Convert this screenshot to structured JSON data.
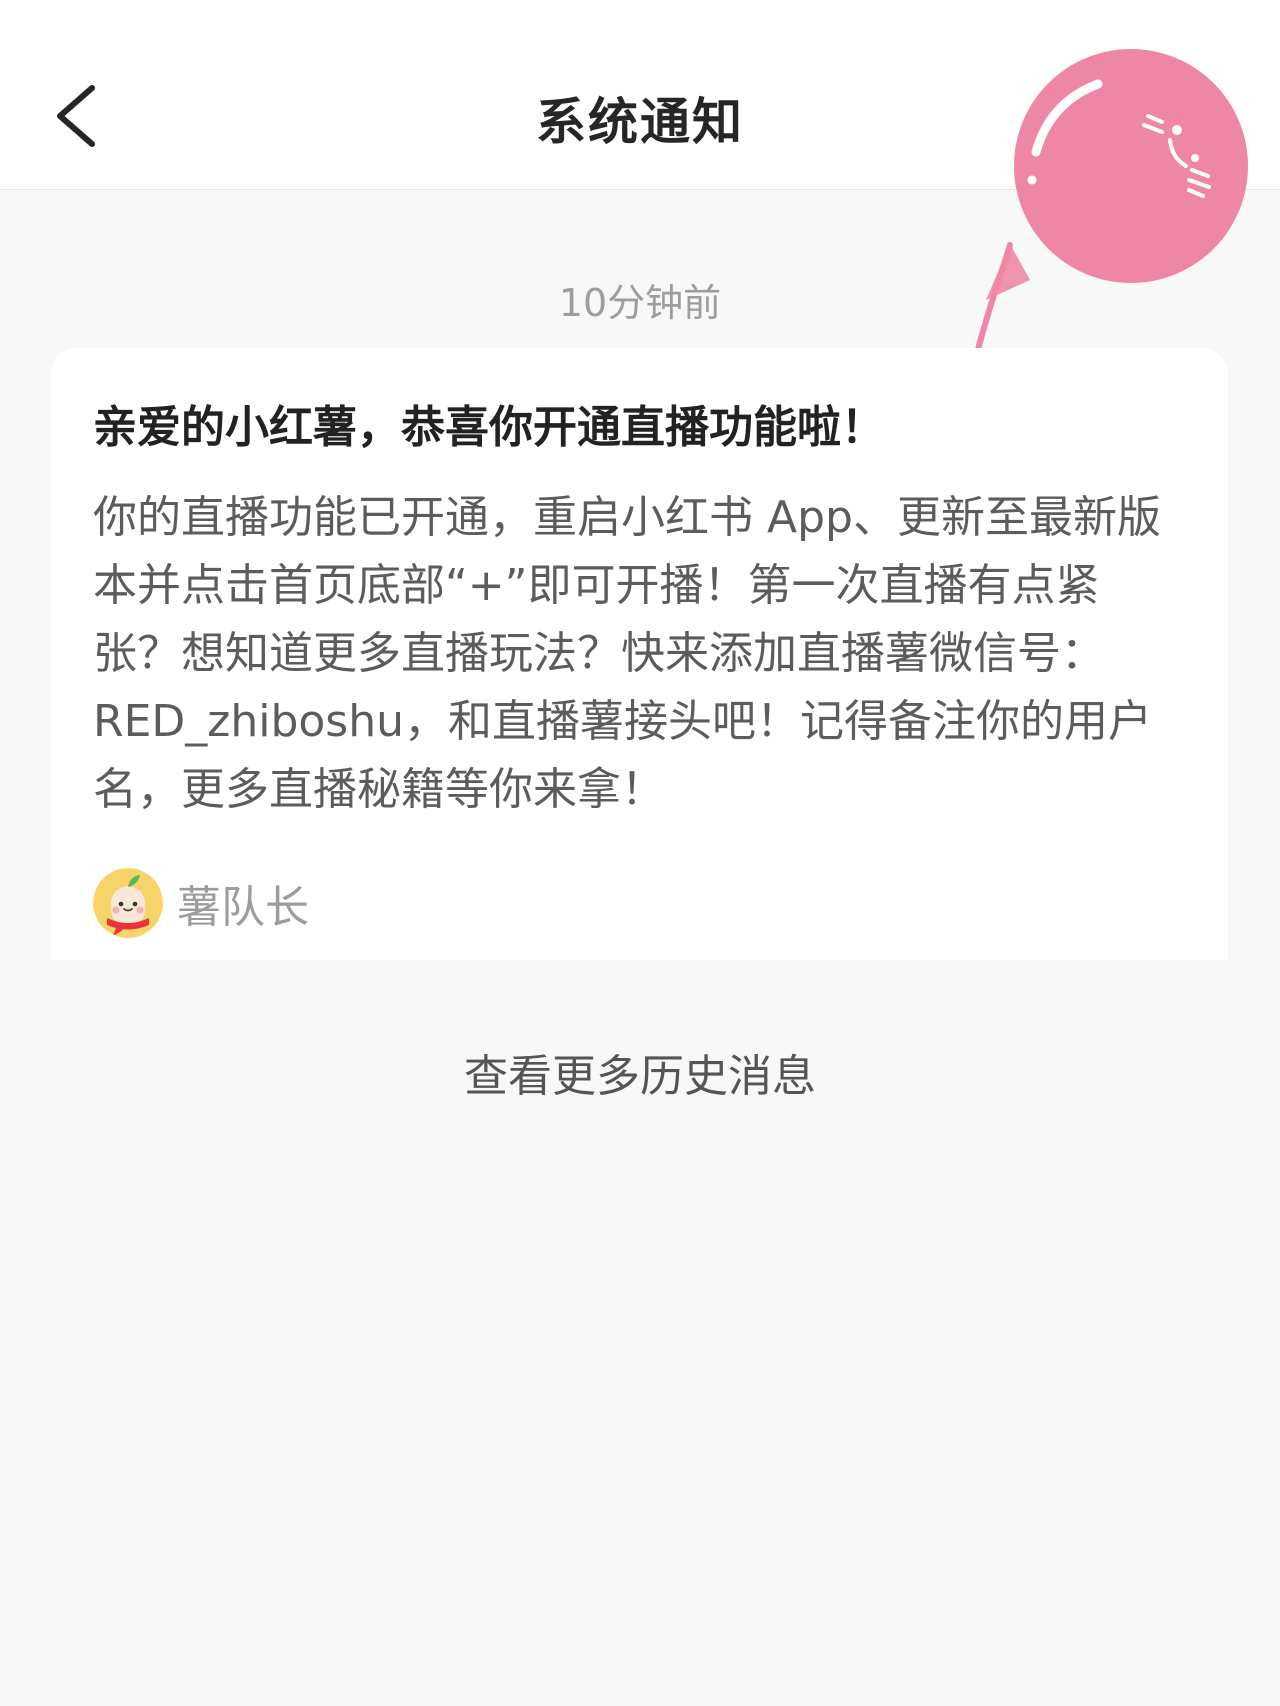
{
  "header": {
    "title": "系统通知",
    "back_icon": "chevron-left-icon"
  },
  "decoration": {
    "balloon_icon": "balloon-icon",
    "balloon_color": "#ee87a5"
  },
  "notification": {
    "time": "10分钟前",
    "title": "亲爱的小红薯，恭喜你开通直播功能啦！",
    "body": "你的直播功能已开通，重启小红书 App、更新至最新版本并点击首页底部“+”即可开播！第一次直播有点紧张？想知道更多直播玩法？快来添加直播薯微信号：RED_zhiboshu，和直播薯接头吧！记得备注你的用户名，更多直播秘籍等你来拿！",
    "sender": {
      "name": "薯队长",
      "avatar_icon": "potato-avatar-icon"
    }
  },
  "footer": {
    "view_more": "查看更多历史消息"
  },
  "colors": {
    "page_background": "#f8f8f8",
    "card_background": "#ffffff",
    "accent_pink": "#ee87a5"
  }
}
